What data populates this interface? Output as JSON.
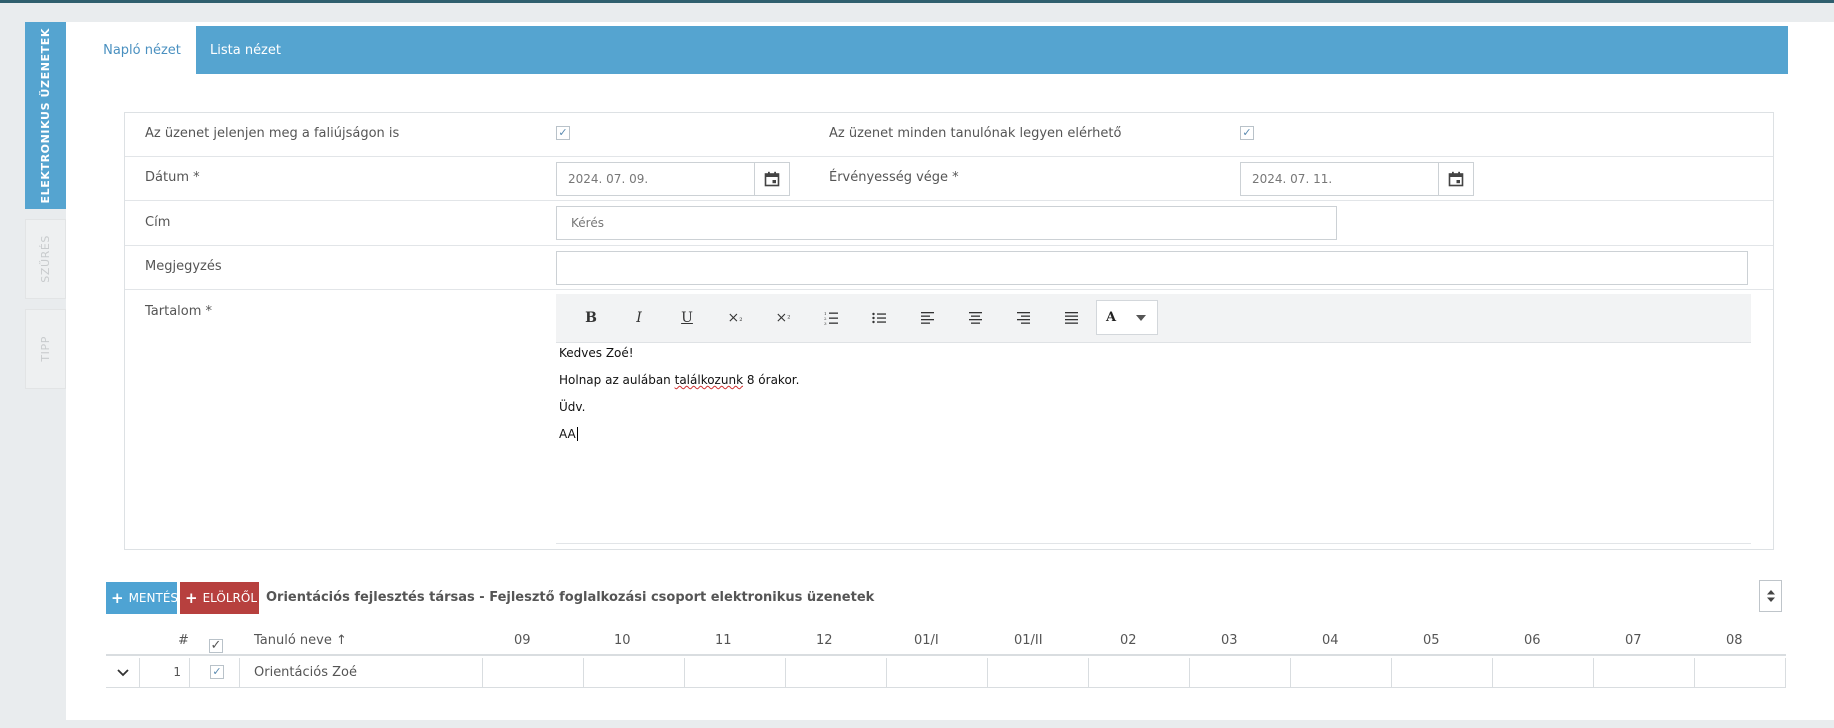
{
  "side_tabs": [
    {
      "label": "ELEKTRONIKUS ÜZENETEK",
      "active": true
    },
    {
      "label": "SZŰRÉS",
      "active": false
    },
    {
      "label": "TIPP",
      "active": false
    }
  ],
  "tabs": [
    {
      "label": "Napló nézet",
      "active": true
    },
    {
      "label": "Lista nézet",
      "active": false
    }
  ],
  "form": {
    "show_on_wall_label": "Az üzenet jelenjen meg a faliújságon is",
    "show_on_wall_checked": true,
    "available_all_label": "Az üzenet minden tanulónak legyen elérhető",
    "available_all_checked": true,
    "date_label": "Dátum *",
    "date_value": "2024. 07. 09.",
    "valid_until_label": "Érvényesség vége *",
    "valid_until_value": "2024. 07. 11.",
    "title_label": "Cím",
    "title_value": "Kérés",
    "note_label": "Megjegyzés",
    "note_value": "",
    "content_label": "Tartalom *"
  },
  "editor": {
    "toolbar": [
      "bold",
      "italic",
      "underline",
      "subscript",
      "superscript",
      "ordered-list",
      "unordered-list",
      "align-left",
      "align-center",
      "align-right",
      "justify",
      "font-color"
    ],
    "color_button_letter": "A",
    "lines": [
      "Kedves Zoé!",
      "Holnap az aulában",
      "találkozunk",
      "8 órakor.",
      "Üdv.",
      "AA"
    ]
  },
  "actions": {
    "save_label": "MENTÉS",
    "reset_label": "ELÖLRŐL",
    "save_color": "#4ea3d3",
    "reset_color": "#b7403e"
  },
  "group_title": "Orientációs fejlesztés társas - Fejlesztő foglalkozási csoport elektronikus üzenetek",
  "table": {
    "headers": {
      "index": "#",
      "name": "Tanuló neve",
      "sort_arrow": "↑"
    },
    "columns": [
      "09",
      "10",
      "11",
      "12",
      "01/I",
      "01/II",
      "02",
      "03",
      "04",
      "05",
      "06",
      "07",
      "08"
    ],
    "rows": [
      {
        "index": "1",
        "checked": true,
        "name": "Orientációs Zoé"
      }
    ]
  },
  "colors": {
    "accent": "#55a4d0",
    "topline": "#2f5f6e"
  }
}
